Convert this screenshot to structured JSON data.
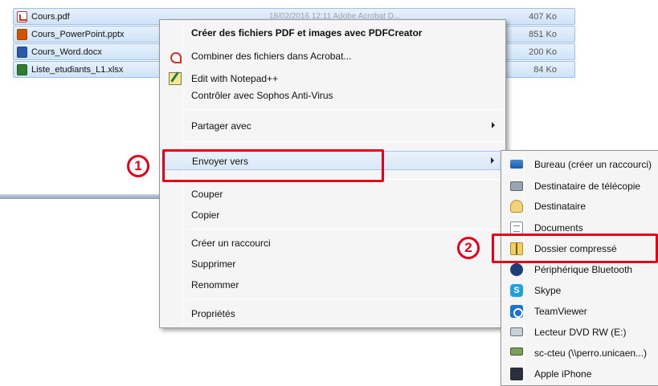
{
  "files": [
    {
      "name": "Cours.pdf",
      "meta": "18/02/2016 12:11    Adobe Acrobat D...",
      "size": "407 Ko",
      "icon": "pdf-file-icon"
    },
    {
      "name": "Cours_PowerPoint.pptx",
      "meta": "",
      "size": "851 Ko",
      "icon": "powerpoint-file-icon"
    },
    {
      "name": "Cours_Word.docx",
      "meta": "",
      "size": "200 Ko",
      "icon": "word-file-icon"
    },
    {
      "name": "Liste_etudiants_L1.xlsx",
      "meta": "",
      "size": "84 Ko",
      "icon": "excel-file-icon"
    }
  ],
  "context_menu": {
    "items": [
      {
        "label": "Créer des fichiers PDF et images avec PDFCreator",
        "bold": true
      },
      {
        "label": "Combiner des fichiers dans Acrobat...",
        "icon": "acrobat-icon"
      },
      {
        "label": "Edit with Notepad++",
        "icon": "notepad-icon"
      },
      {
        "label": "Contrôler avec Sophos Anti-Virus"
      },
      {
        "label": "Partager avec",
        "submenu": true
      },
      {
        "label": "Envoyer vers",
        "submenu": true
      },
      {
        "label": "Couper"
      },
      {
        "label": "Copier"
      },
      {
        "label": "Créer un raccourci"
      },
      {
        "label": "Supprimer"
      },
      {
        "label": "Renommer"
      },
      {
        "label": "Propriétés"
      }
    ]
  },
  "send_to_menu": {
    "items": [
      {
        "label": "Bureau (créer un raccourci)",
        "icon": "desktop-icon"
      },
      {
        "label": "Destinataire de télécopie",
        "icon": "fax-icon"
      },
      {
        "label": "Destinataire",
        "icon": "mail-icon"
      },
      {
        "label": "Documents",
        "icon": "documents-icon"
      },
      {
        "label": "Dossier compressé",
        "icon": "zip-folder-icon"
      },
      {
        "label": "Périphérique Bluetooth",
        "icon": "bluetooth-icon"
      },
      {
        "label": "Skype",
        "icon": "skype-icon"
      },
      {
        "label": "TeamViewer",
        "icon": "teamviewer-icon"
      },
      {
        "label": "Lecteur DVD RW (E:)",
        "icon": "dvd-drive-icon"
      },
      {
        "label": "sc-cteu (\\\\perro.unicaen...)",
        "icon": "network-drive-icon"
      },
      {
        "label": "Apple iPhone",
        "icon": "iphone-icon"
      }
    ]
  },
  "callouts": {
    "step1": "1",
    "step2": "2"
  },
  "colors": {
    "highlight": "#e3001b",
    "selection": "#cfe3f8"
  }
}
